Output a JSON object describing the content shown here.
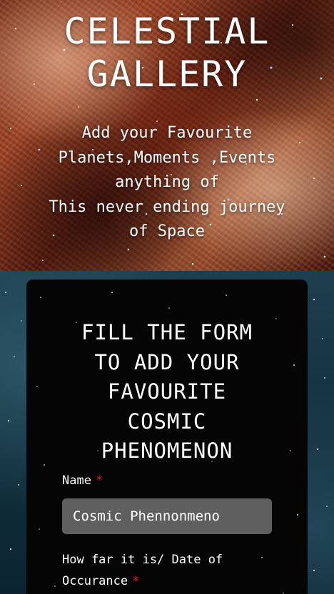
{
  "hero": {
    "title": "CELESTIAL\nGALLERY",
    "subtitle": "Add your Favourite\nPlanets,Moments ,Events\nanything of\nThis never ending journey\nof Space"
  },
  "form": {
    "heading": "FILL THE FORM\nTO ADD YOUR\nFAVOURITE\nCOSMIC\nPHENOMENON",
    "fields": [
      {
        "label": "Name",
        "required_mark": "*",
        "value": "Cosmic Phennonmeno"
      },
      {
        "label": "How far it is/ Date of Occurance",
        "required_mark": "*"
      }
    ]
  },
  "colors": {
    "required": "#e0212a",
    "card_background": "#050505",
    "input_background": "#5f5f5f"
  }
}
